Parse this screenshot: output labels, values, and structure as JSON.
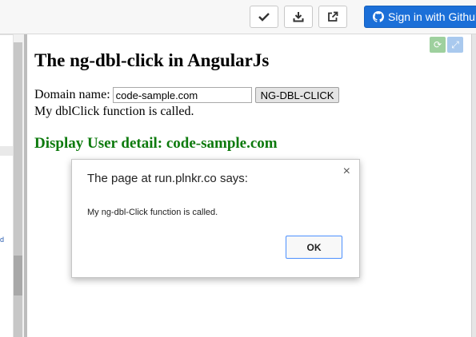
{
  "toolbar": {
    "check_icon": "check-icon",
    "download_icon": "download-icon",
    "external_icon": "external-link-icon",
    "signin_label": "Sign in with Github",
    "signin_color": "#1b6fd8"
  },
  "left_pane": {
    "fragment_text": "d"
  },
  "preview": {
    "heading": "The ng-dbl-click in AngularJs",
    "domain_label": "Domain name:",
    "domain_value": "code-sample.com",
    "dbl_button_label": "NG-DBL-CLICK",
    "called_message": "My dblClick function is called.",
    "user_detail": "Display User detail: code-sample.com",
    "user_detail_color": "#0d7a0d"
  },
  "dialog": {
    "title": "The page at run.plnkr.co says:",
    "close_glyph": "×",
    "message": "My ng-dbl-Click function is called.",
    "ok_label": "OK"
  }
}
